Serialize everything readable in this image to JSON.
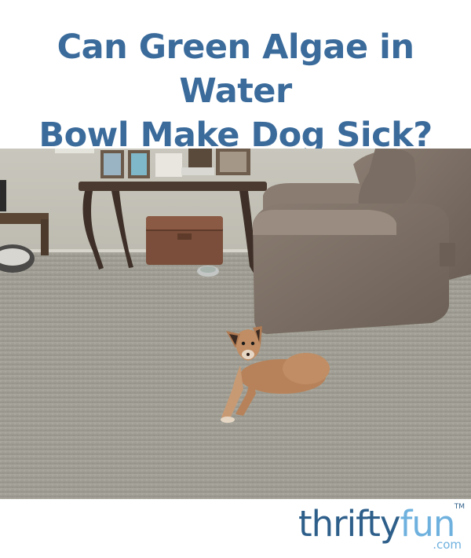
{
  "title": {
    "line1": "Can Green Algae in Water",
    "line2": "Bowl Make Dog Sick?"
  },
  "colors": {
    "title": "#3b6b9b",
    "logo_dark": "#2e5f8a",
    "logo_light": "#6fb1de"
  },
  "logo": {
    "thrifty": "thrifty",
    "fun": "fun",
    "dotcom": ".com",
    "tm": "TM"
  }
}
